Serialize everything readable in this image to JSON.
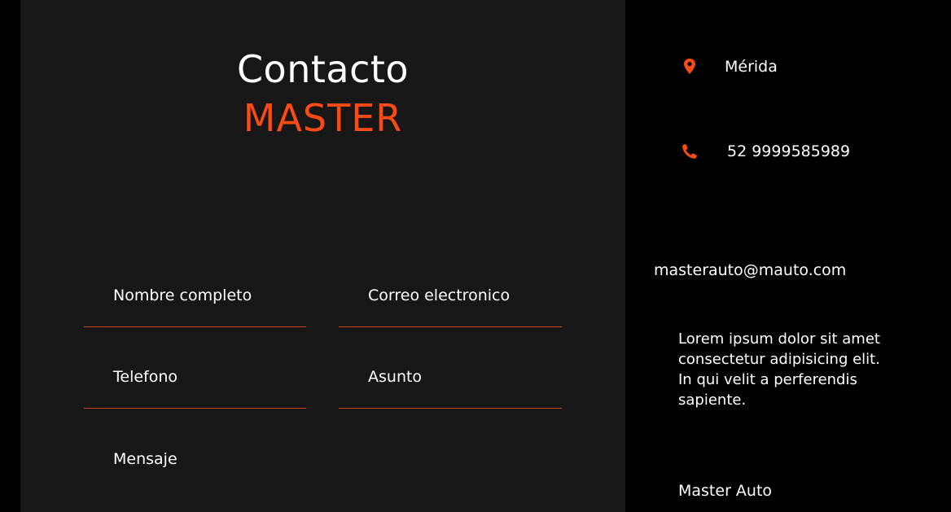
{
  "header": {
    "title": "Contacto",
    "accent_title": "MASTER"
  },
  "form": {
    "fields": [
      {
        "label": "Nombre completo"
      },
      {
        "label": "Correo electronico"
      },
      {
        "label": "Telefono"
      },
      {
        "label": "Asunto"
      },
      {
        "label": "Mensaje"
      }
    ]
  },
  "contact_info": {
    "location": "Mérida",
    "phone": "52 9999585989",
    "email": "masterauto@mauto.com",
    "description": "Lorem ipsum dolor sit amet consectetur adipisicing elit. In qui velit a perferendis sapiente.",
    "brand": "Master Auto"
  },
  "icons": {
    "location": "map-marker-icon",
    "phone": "phone-icon"
  },
  "colors": {
    "accent": "#fa4b16",
    "panel_bg": "#171717",
    "page_bg": "#000000",
    "text": "#ffffff"
  }
}
